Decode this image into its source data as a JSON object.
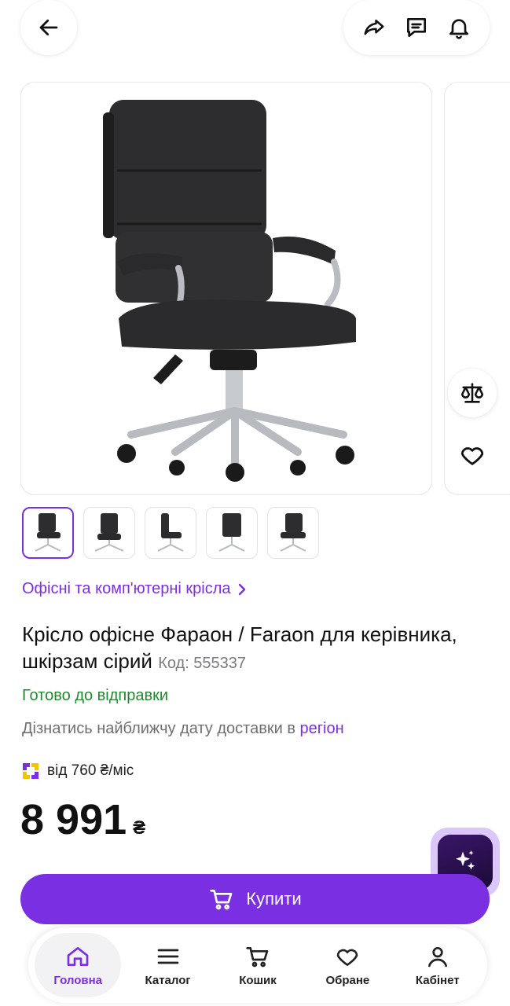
{
  "header": {
    "back_icon": "arrow-left-icon",
    "share_icon": "share-icon",
    "chat_icon": "chat-icon",
    "notify_icon": "bell-icon"
  },
  "gallery": {
    "side_actions": [
      "compare-icon",
      "heart-icon"
    ],
    "thumbnail_count": 5
  },
  "breadcrumb": {
    "label": "Офісні та комп'ютерні крісла"
  },
  "product": {
    "title": "Крісло офісне Фараон / Faraon для керівника, шкірзам сірий",
    "code_label": "Код: 555337",
    "status": "Готово до відправки",
    "delivery_text": "Дізнатись найближчу дату доставки в",
    "delivery_link": "регіон",
    "credit_text": "від 760 ₴/міс",
    "price": "8 991",
    "currency": "₴"
  },
  "actions": {
    "buy_label": "Купити"
  },
  "tabbar": {
    "items": [
      {
        "label": "Головна",
        "icon": "home-icon",
        "active": true
      },
      {
        "label": "Каталог",
        "icon": "menu-icon",
        "active": false
      },
      {
        "label": "Кошик",
        "icon": "cart-icon",
        "active": false
      },
      {
        "label": "Обране",
        "icon": "heart-icon",
        "active": false
      },
      {
        "label": "Кабінет",
        "icon": "user-icon",
        "active": false
      }
    ]
  },
  "colors": {
    "accent": "#7b2fe3",
    "success": "#1f8a2d"
  }
}
